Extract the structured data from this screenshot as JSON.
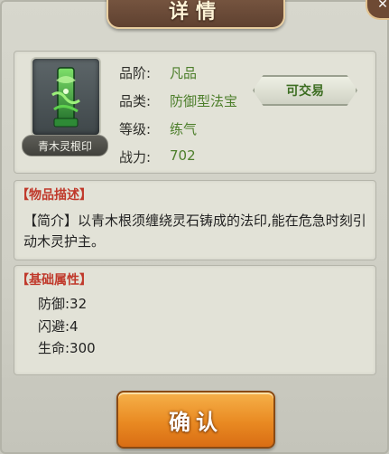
{
  "title": "详情",
  "item": {
    "name": "青木灵根印",
    "icon": "jade-seal-icon"
  },
  "stats": [
    {
      "label": "品阶:",
      "value": "凡品"
    },
    {
      "label": "品类:",
      "value": "防御型法宝"
    },
    {
      "label": "等级:",
      "value": "练气"
    },
    {
      "label": "战力:",
      "value": "702"
    }
  ],
  "trade_badge": "可交易",
  "description": {
    "title": "【物品描述】",
    "text": "【简介】以青木根须缠绕灵石铸成的法印,能在危急时刻引动木灵护主。"
  },
  "attributes": {
    "title": "【基础属性】",
    "lines": [
      "防御:32",
      "闪避:4",
      "生命:300"
    ]
  },
  "confirm_label": "确认",
  "colors": {
    "accent_green": "#4c7e2a",
    "section_red": "#c0392b",
    "button_orange": "#e98a22"
  }
}
